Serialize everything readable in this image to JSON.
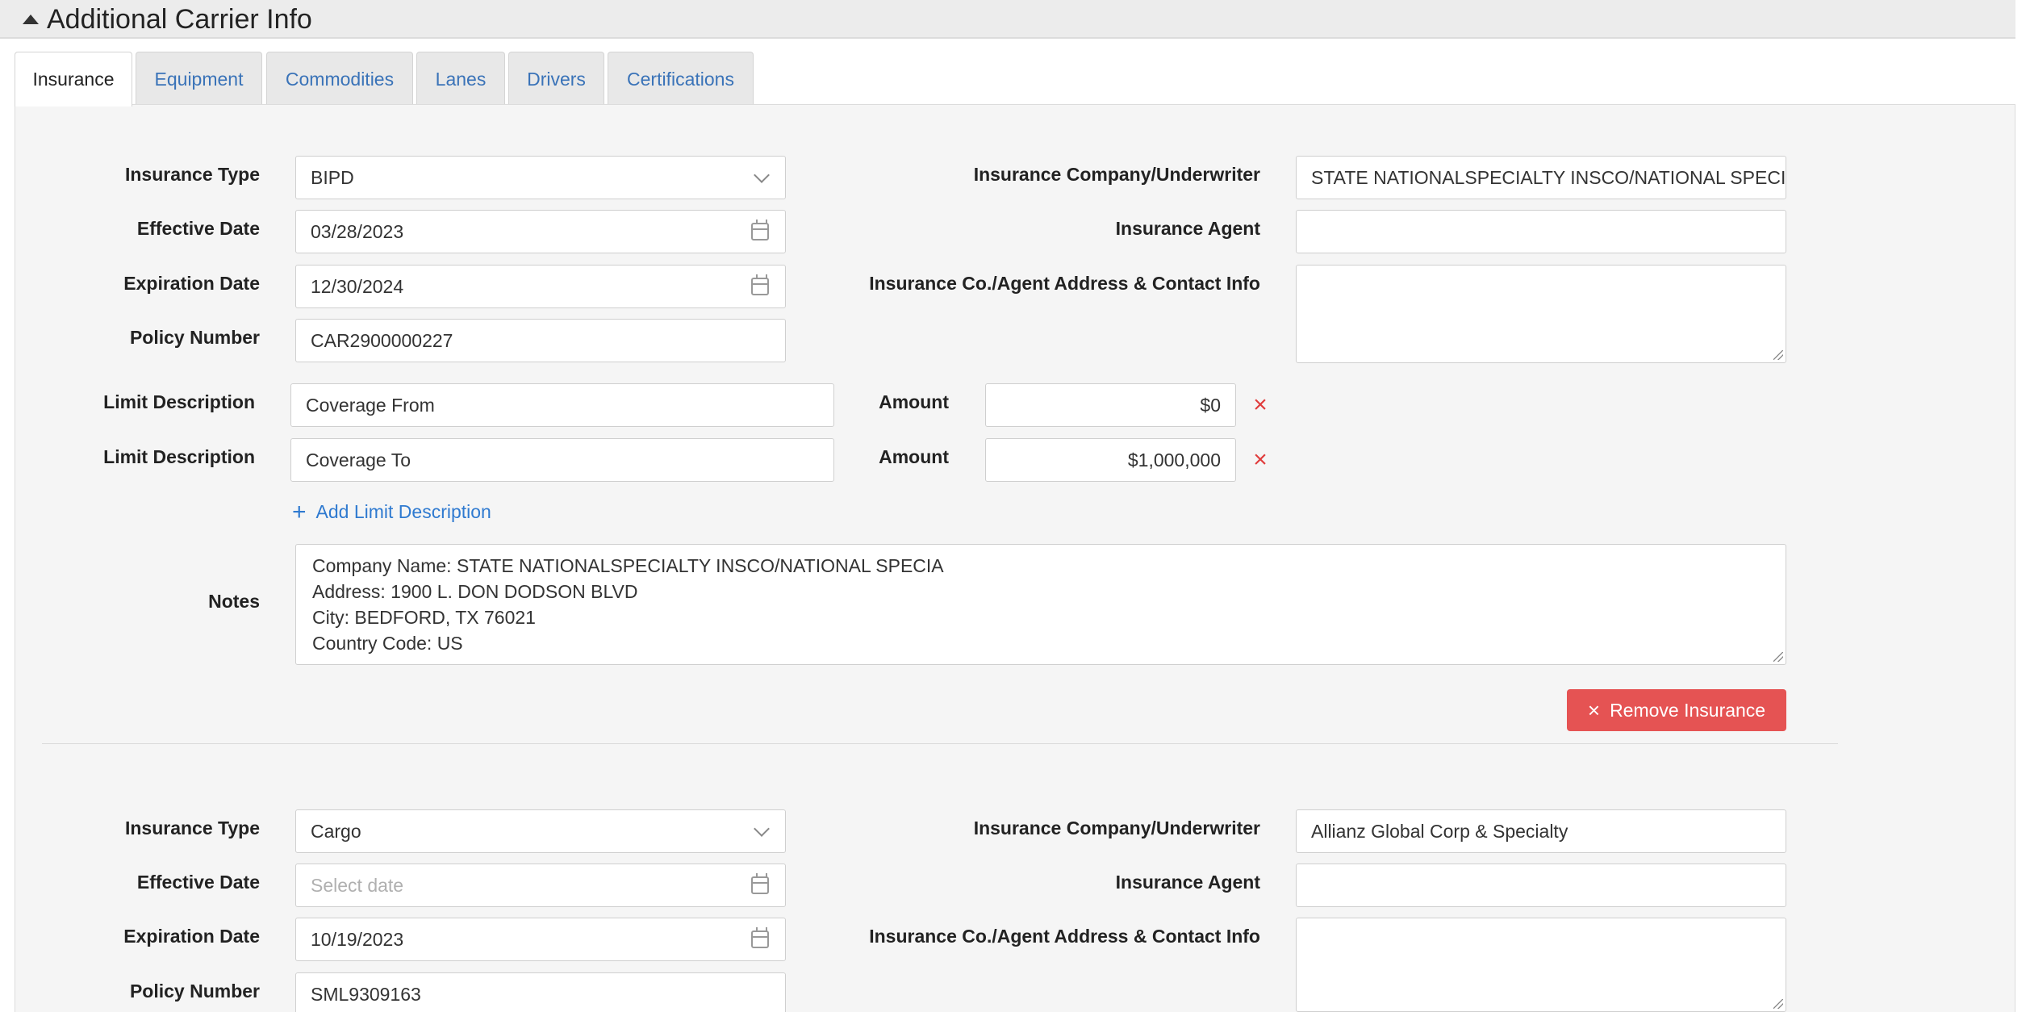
{
  "header": {
    "title": "Additional Carrier Info"
  },
  "tabs": [
    "Insurance",
    "Equipment",
    "Commodities",
    "Lanes",
    "Drivers",
    "Certifications"
  ],
  "labels": {
    "insurance_type": "Insurance Type",
    "effective_date": "Effective Date",
    "expiration_date": "Expiration Date",
    "policy_number": "Policy Number",
    "company": "Insurance Company/Underwriter",
    "agent": "Insurance Agent",
    "address": "Insurance Co./Agent Address & Contact Info",
    "limit_description": "Limit Description",
    "amount": "Amount",
    "notes": "Notes"
  },
  "insurance": [
    {
      "type": "BIPD",
      "effective_date": "03/28/2023",
      "expiration_date": "12/30/2024",
      "policy_number": "CAR2900000227",
      "company": "STATE NATIONALSPECIALTY INSCO/NATIONAL SPECIA",
      "agent": "",
      "address": "",
      "limits": [
        {
          "description": "Coverage From",
          "amount": "$0"
        },
        {
          "description": "Coverage To",
          "amount": "$1,000,000"
        }
      ],
      "add_limit_label": "Add Limit Description",
      "notes": [
        "Company Name: STATE NATIONALSPECIALTY INSCO/NATIONAL SPECIA",
        "Address: 1900 L. DON DODSON BLVD",
        "City: BEDFORD, TX 76021",
        "Country Code: US"
      ],
      "remove_label": "Remove Insurance"
    },
    {
      "type": "Cargo",
      "effective_date": "",
      "effective_date_placeholder": "Select date",
      "expiration_date": "10/19/2023",
      "policy_number": "SML9309163",
      "company": "Allianz Global Corp & Specialty",
      "agent": "",
      "address": ""
    }
  ]
}
